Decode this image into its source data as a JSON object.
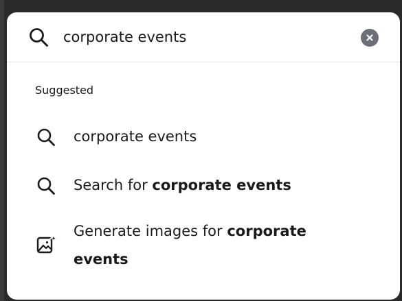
{
  "search": {
    "value": "corporate events",
    "icon": "search-icon",
    "clear_icon": "close-icon"
  },
  "suggestions_section": {
    "label": "Suggested"
  },
  "suggestions": [
    {
      "icon": "search-icon",
      "text": "corporate events"
    },
    {
      "icon": "search-icon",
      "prefix": "Search for ",
      "bold": "corporate events"
    },
    {
      "icon": "image-sparkle-icon",
      "prefix": "Generate images for ",
      "bold_line1": "corporate",
      "bold_line2": "events"
    }
  ],
  "colors": {
    "background": "#2a2a2c",
    "panel": "#ffffff",
    "text": "#1a1a1a",
    "clear_button": "#6b6f76",
    "divider": "#e6e6ea"
  }
}
